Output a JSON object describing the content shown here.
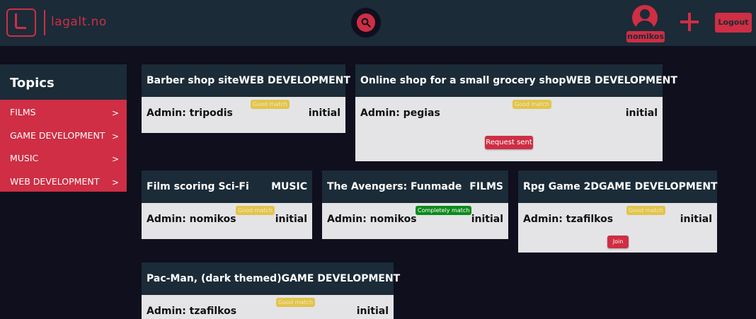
{
  "header": {
    "logo_text": "lagalt.no",
    "user_name": "nomikos",
    "logout_label": "Logout"
  },
  "sidebar": {
    "title": "Topics",
    "items": [
      {
        "label": "FILMS"
      },
      {
        "label": "GAME DEVELOPMENT"
      },
      {
        "label": "MUSIC"
      },
      {
        "label": "WEB DEVELOPMENT"
      }
    ],
    "chevron": ">"
  },
  "projects": [
    {
      "title": "Barber shop site",
      "category": "WEB DEVELOPMENT",
      "admin": "Admin: tripodis",
      "status": "initial",
      "match": "Good match"
    },
    {
      "title": "Online shop for a small grocery shop",
      "category": "WEB DEVELOPMENT",
      "admin": "Admin: pegias",
      "status": "initial",
      "match": "Good match",
      "action": "Request sent"
    },
    {
      "title": "Film scoring Sci-Fi",
      "category": "MUSIC",
      "admin": "Admin: nomikos",
      "status": "initial",
      "match": "Good match"
    },
    {
      "title": "The Avengers: Funmade",
      "category": "FILMS",
      "admin": "Admin: nomikos",
      "status": "initial",
      "match": "Completely match"
    },
    {
      "title": "Rpg Game 2D",
      "category": "GAME DEVELOPMENT",
      "admin": "Admin: tzafilkos",
      "status": "initial",
      "match": "Good match",
      "action": "Join"
    },
    {
      "title": "Pac-Man, (dark themed)",
      "category": "GAME DEVELOPMENT",
      "admin": "Admin: tzafilkos",
      "status": "initial",
      "match": "Good match"
    }
  ],
  "colors": {
    "accent": "#cf2e44",
    "header_bg": "#1b2b38",
    "page_bg": "#0f0f1e",
    "good_match": "#e2c44c",
    "complete_match": "#0d8a1c"
  }
}
